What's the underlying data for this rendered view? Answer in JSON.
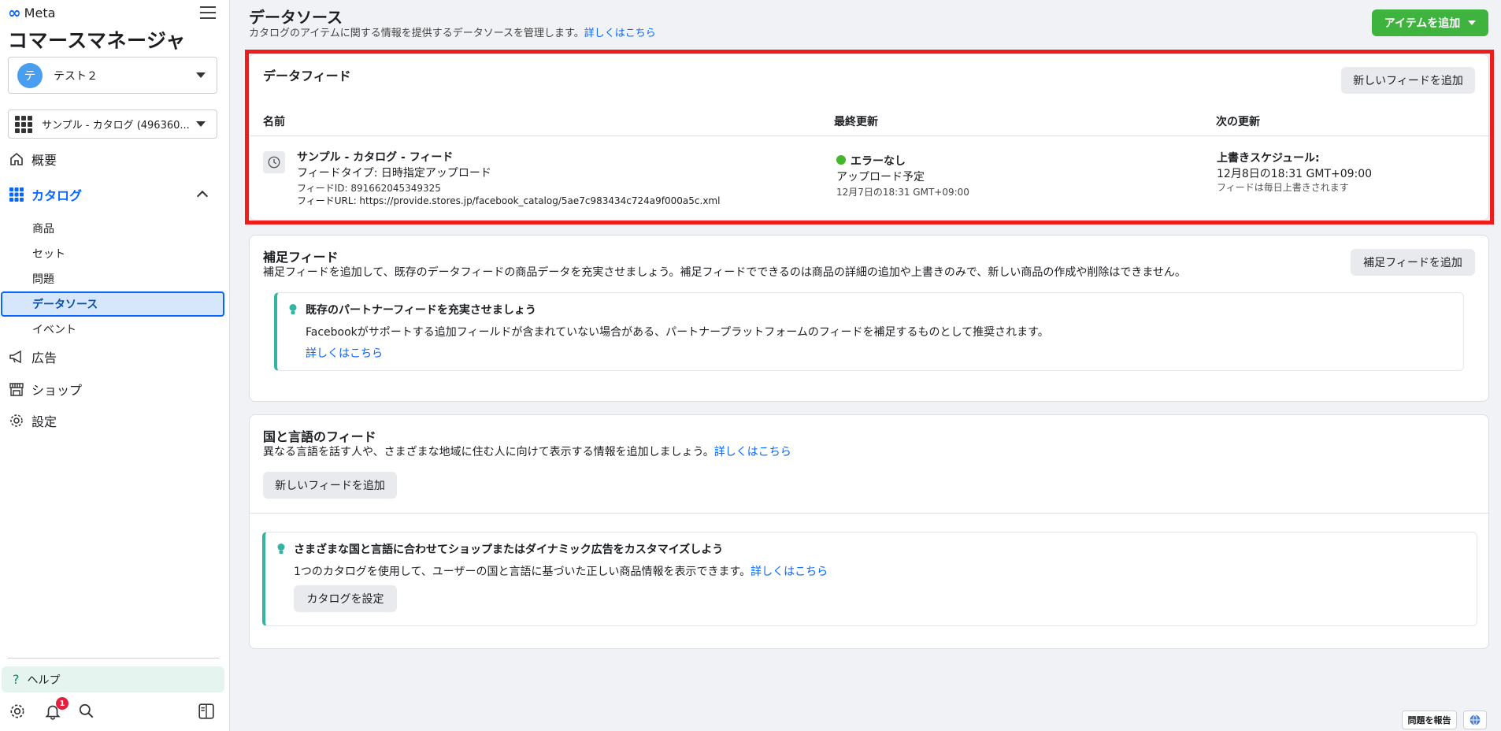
{
  "sidebar": {
    "brand": "Meta",
    "app_title": "コマースマネージャ",
    "account": {
      "avatar_letter": "テ",
      "name": "テスト２"
    },
    "catalog": {
      "name": "サンプル - カタログ (496360..."
    },
    "nav": {
      "overview": "概要",
      "catalog": "カタログ",
      "catalog_sub": [
        "商品",
        "セット",
        "問題",
        "データソース",
        "イベント"
      ],
      "ads": "広告",
      "shop": "ショップ",
      "settings": "設定"
    },
    "help": "ヘルプ",
    "notification_count": "1"
  },
  "header": {
    "title": "データソース",
    "description": "カタログのアイテムに関する情報を提供するデータソースを管理します。",
    "learn_more": "詳しくはこちら",
    "add_item_button": "アイテムを追加"
  },
  "data_feed": {
    "title": "データフィード",
    "add_feed_button": "新しいフィードを追加",
    "columns": [
      "名前",
      "最終更新",
      "次の更新"
    ],
    "feed": {
      "name": "サンプル - カタログ - フィード",
      "type": "フィードタイプ: 日時指定アップロード",
      "id": "フィードID: 891662045349325",
      "url": "フィードURL: https://provide.stores.jp/facebook_catalog/5ae7c983434c724a9f000a5c.xml",
      "status": "エラーなし",
      "last_update_label": "アップロード予定",
      "last_update_time": "12月7日の18:31 GMT+09:00",
      "next_update_title": "上書きスケジュール:",
      "next_update_time": "12月8日の18:31 GMT+09:00",
      "next_update_note": "フィードは毎日上書きされます"
    }
  },
  "supplementary": {
    "title": "補足フィード",
    "description": "補足フィードを追加して、既存のデータフィードの商品データを充実させましょう。補足フィードでできるのは商品の詳細の追加や上書きのみで、新しい商品の作成や削除はできません。",
    "add_button": "補足フィードを追加",
    "tip": {
      "title": "既存のパートナーフィードを充実させましょう",
      "body": "Facebookがサポートする追加フィールドが含まれていない場合がある、パートナープラットフォームのフィードを補足するものとして推奨されます。",
      "link": "詳しくはこちら"
    }
  },
  "country_language": {
    "title": "国と言語のフィード",
    "description": "異なる言語を話す人や、さまざまな地域に住む人に向けて表示する情報を追加しましょう。",
    "link": "詳しくはこちら",
    "add_button": "新しいフィードを追加",
    "tip": {
      "title": "さまざまな国と言語に合わせてショップまたはダイナミック広告をカスタマイズしよう",
      "body": "1つのカタログを使用して、ユーザーの国と言語に基づいた正しい商品情報を表示できます。",
      "link": "詳しくはこちら",
      "button": "カタログを設定"
    }
  },
  "footer": {
    "report_button": "問題を報告"
  },
  "colors": {
    "accent": "#0866ff",
    "success": "#42b72a",
    "add_button": "#3eb33e",
    "highlight": "#f01b1b",
    "tip_border": "#31b5a0"
  }
}
